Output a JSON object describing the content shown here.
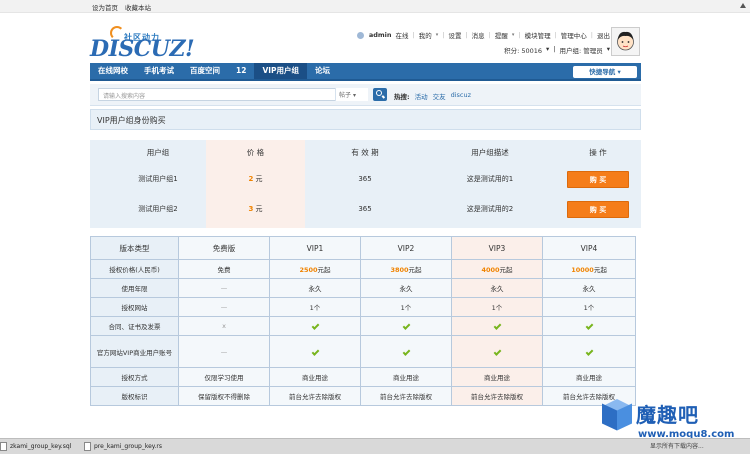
{
  "topbar": {
    "links": [
      "设为首页",
      "收藏本站"
    ]
  },
  "logo": {
    "cn": "社区动力",
    "en": "DISCUZ!"
  },
  "userbar": {
    "username": "admin",
    "status": "在线",
    "links": [
      "我的",
      "设置",
      "消息",
      "提醒",
      "模块管理",
      "管理中心",
      "退出"
    ],
    "credits": "积分: 50016",
    "group": "用户组: 管理员"
  },
  "nav": {
    "items": [
      "在线网校",
      "手机考试",
      "百度空间",
      "12",
      "VIP用户组",
      "论坛"
    ],
    "active_index": 4,
    "quick_nav": "快捷导航"
  },
  "search": {
    "placeholder": "请输入搜索内容",
    "scope": "帖子",
    "hot_label": "热搜:",
    "hot_terms": [
      "活动",
      "交友",
      "discuz"
    ]
  },
  "page_title": "VIP用户组身份购买",
  "groups": {
    "headers": [
      "用户组",
      "价 格",
      "有 效 期",
      "用户组描述",
      "操 作"
    ],
    "rows": [
      {
        "name": "测试用户组1",
        "price": "2",
        "unit": "元",
        "period": "365",
        "desc": "这是测试用的1",
        "action": "购 买"
      },
      {
        "name": "测试用户组2",
        "price": "3",
        "unit": "元",
        "period": "365",
        "desc": "这是测试用的2",
        "action": "购 买"
      }
    ]
  },
  "compare": {
    "headers": [
      "版本类型",
      "免费版",
      "VIP1",
      "VIP2",
      "VIP3",
      "VIP4"
    ],
    "price_row": {
      "label": "授权价格(人民币)",
      "free": "免费",
      "v1": "2500",
      "v2": "3800",
      "v3": "4000",
      "v4": "10000",
      "suffix": "元起"
    },
    "years_row": {
      "label": "使用年限",
      "free": "—",
      "v1": "永久",
      "v2": "永久",
      "v3": "永久",
      "v4": "永久"
    },
    "sites_row": {
      "label": "授权网站",
      "free": "—",
      "v1": "1个",
      "v2": "1个",
      "v3": "1个",
      "v4": "1个"
    },
    "contract_row": {
      "label": "合同、证书及发票",
      "free": "x"
    },
    "account_row": {
      "label": "官方网站VIP商业用户账号"
    },
    "mode_row": {
      "label": "授权方式",
      "free": "仅限学习使用",
      "v1": "商业用途",
      "v2": "商业用途",
      "v3": "商业用途",
      "v4": "商业用途"
    },
    "mark_row": {
      "label": "版权标识",
      "free": "保留版权不得删除",
      "v1": "前台允许去除版权",
      "v2": "前台允许去除版权",
      "v3": "前台允许去除版权",
      "v4": "前台允许去除版权"
    }
  },
  "watermark": {
    "title": "魔趣吧",
    "url": "www.moqu8.com"
  },
  "taskbar": {
    "items": [
      "zkami_group_key.sql",
      "pre_kami_group_key.rs"
    ],
    "right_text": "显示所有下载内容..."
  },
  "colors": {
    "nav_blue": "#2b6ca9",
    "buy_orange": "#f57d1a",
    "price_orange": "#f08300",
    "check_green": "#78b51e"
  }
}
